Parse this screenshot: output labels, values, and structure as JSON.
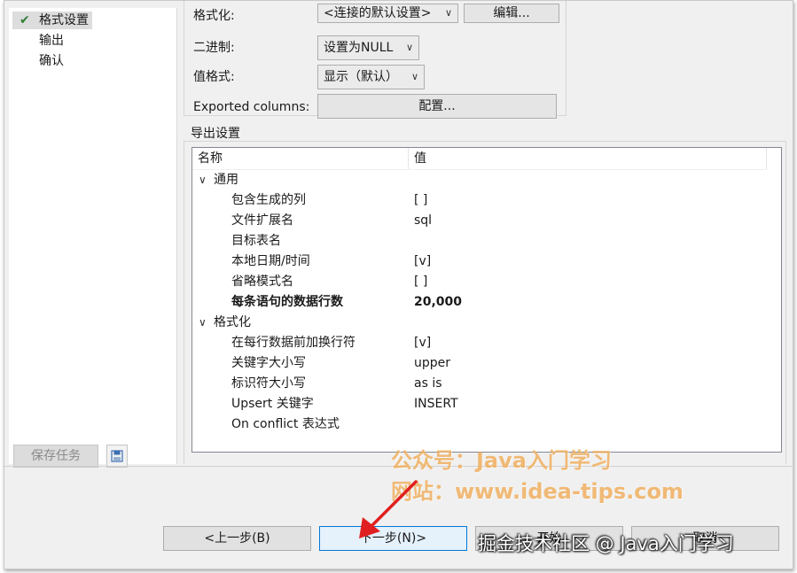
{
  "sidebar": {
    "items": [
      {
        "label": "格式设置",
        "active": true,
        "icon": "check-icon"
      },
      {
        "label": "输出",
        "active": false
      },
      {
        "label": "确认",
        "active": false
      }
    ],
    "save_task_label": "保存任务",
    "save_icon": "save-settings-icon"
  },
  "format_group": {
    "partial_label": "格式化:",
    "partial_combo": "<连接的默认设置>",
    "partial_button": "编辑...",
    "binary_label": "二进制:",
    "binary_value": "设置为NULL",
    "value_format_label": "值格式:",
    "value_format_value": "显示（默认）",
    "exported_columns_label": "Exported columns:",
    "configure_button": "配置..."
  },
  "export_settings": {
    "title": "导出设置",
    "columns": [
      "名称",
      "值"
    ],
    "groups": [
      {
        "label": "通用",
        "expanded": true,
        "rows": [
          {
            "name": "包含生成的列",
            "value": "[ ]"
          },
          {
            "name": "文件扩展名",
            "value": "sql"
          },
          {
            "name": "目标表名",
            "value": ""
          },
          {
            "name": "本地日期/时间",
            "value": "[v]"
          },
          {
            "name": "省略模式名",
            "value": "[ ]"
          },
          {
            "name": "每条语句的数据行数",
            "value": "20,000",
            "bold": true
          }
        ]
      },
      {
        "label": "格式化",
        "expanded": true,
        "rows": [
          {
            "name": "在每行数据前加换行符",
            "value": "[v]"
          },
          {
            "name": "关键字大小写",
            "value": "upper"
          },
          {
            "name": "标识符大小写",
            "value": "as is"
          },
          {
            "name": "Upsert 关键字",
            "value": "INSERT"
          },
          {
            "name": "On conflict 表达式",
            "value": ""
          }
        ]
      }
    ]
  },
  "footer": {
    "back_button": "<上一步(B)",
    "next_button": "下一步(N)>",
    "start_button": "开始",
    "cancel_button": "取消"
  },
  "overlay": {
    "watermark_line1": "公众号：Java入门学习",
    "watermark_line2": "网站：www.idea-tips.com",
    "credit": "掘金技术社区 @ Java入门学习",
    "arrow_color": "#e02020"
  }
}
